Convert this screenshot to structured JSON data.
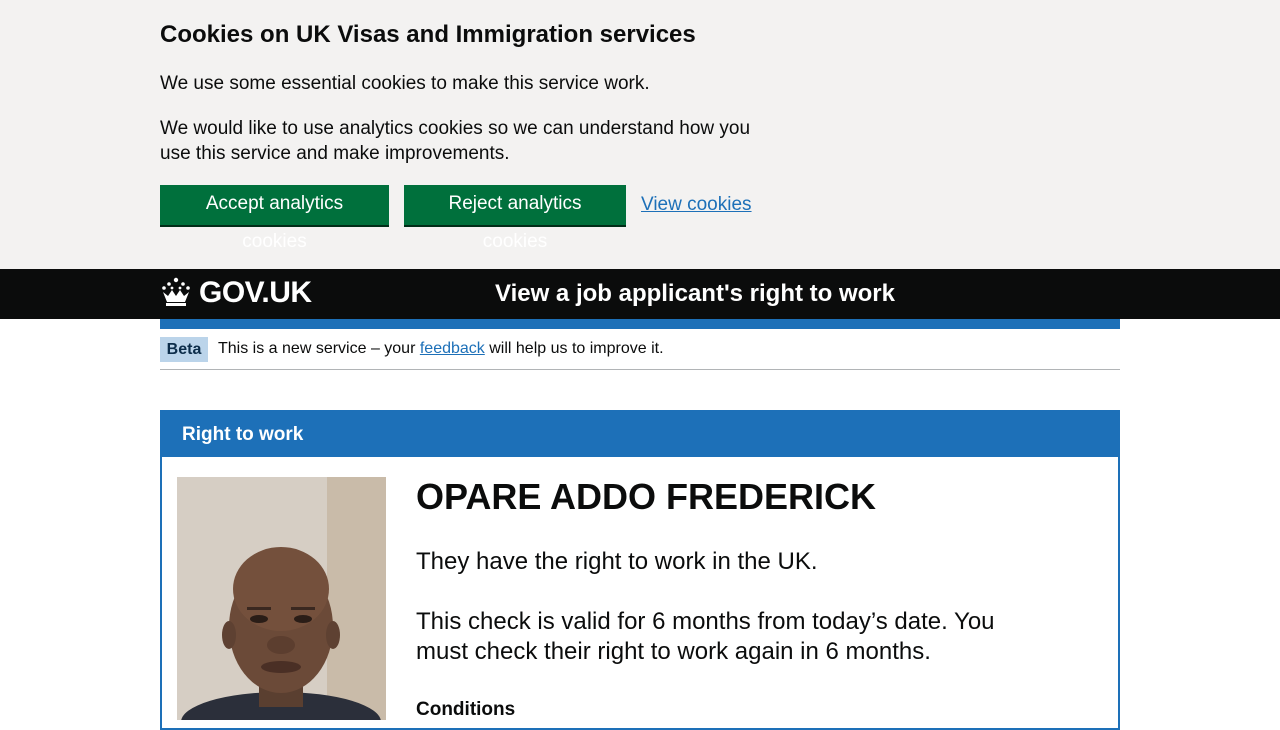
{
  "cookie_banner": {
    "title": "Cookies on UK Visas and Immigration services",
    "essential_text": "We use some essential cookies to make this service work.",
    "analytics_text": "We would like to use analytics cookies so we can understand how you use this service and make improvements.",
    "accept_label": "Accept analytics cookies",
    "reject_label": "Reject analytics cookies",
    "view_label": "View cookies"
  },
  "header": {
    "logo_text": "GOV.UK",
    "logo_icon": "crown-icon",
    "service_name": "View a job applicant's right to work"
  },
  "phase_banner": {
    "tag": "Beta",
    "text_before": "This is a new service – your ",
    "link_text": "feedback",
    "text_after": " will help us to improve it."
  },
  "panel": {
    "title": "Right to work",
    "photo_icon": "applicant-photo",
    "name": "OPARE ADDO FREDERICK",
    "status": "They have the right to work in the UK.",
    "validity": "This check is valid for 6 months from today’s date. You must check their right to work again in 6 months.",
    "conditions_heading": "Conditions"
  },
  "colors": {
    "banner_bg": "#f3f2f1",
    "button_green": "#00703c",
    "link_blue": "#1d70b8",
    "header_black": "#0b0c0c",
    "beta_tag_bg": "#bbd4ea"
  }
}
